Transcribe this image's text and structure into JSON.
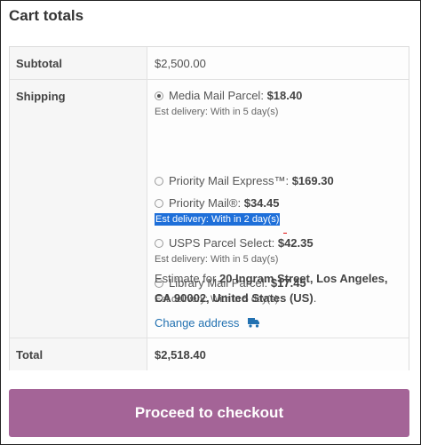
{
  "cart_totals": {
    "title": "Cart totals",
    "subtotal": {
      "label": "Subtotal",
      "value": "$2,500.00"
    },
    "shipping": {
      "label": "Shipping",
      "methods": [
        {
          "name": "Media Mail Parcel:",
          "price": "$18.40",
          "estimate": "Est delivery: With in 5 day(s)",
          "selected": true
        },
        {
          "name": "Priority Mail Express™:",
          "price": "$169.30",
          "estimate": "",
          "selected": false
        },
        {
          "name": "Priority Mail®:",
          "price": "$34.45",
          "estimate": "Est delivery: With in 2 day(s)",
          "selected": false
        },
        {
          "name": "USPS Parcel Select:",
          "price": "$42.35",
          "estimate": "Est delivery: With in 5 day(s)",
          "selected": false
        },
        {
          "name": "Library Mail Parcel:",
          "price": "$17.45",
          "estimate": "Est delivery: With in 5 day(s)",
          "selected": false
        }
      ],
      "estimate_prefix": "Estimate for",
      "estimate_address": "20 Ingram Street, Los Angeles, CA 90002, United States (US)",
      "estimate_suffix": ".",
      "change_address_label": "Change address",
      "change_address_icon": "truck-icon"
    },
    "total": {
      "label": "Total",
      "value": "$2,518.40"
    }
  },
  "checkout": {
    "label": "Proceed to checkout"
  },
  "colors": {
    "checkout_button": "#a46497",
    "link": "#2271b1",
    "text_selection": "#1e6fd9"
  }
}
